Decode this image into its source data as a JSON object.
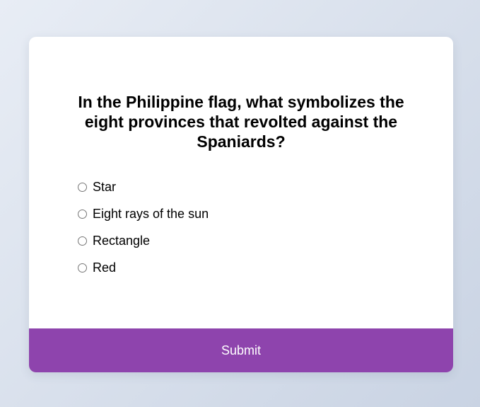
{
  "quiz": {
    "question": "In the Philippine flag, what symbolizes the eight provinces that revolted against the Spaniards?",
    "answers": [
      {
        "label": "Star",
        "selected": false
      },
      {
        "label": "Eight rays of the sun",
        "selected": false
      },
      {
        "label": "Rectangle",
        "selected": false
      },
      {
        "label": "Red",
        "selected": false
      }
    ],
    "submit_label": "Submit"
  },
  "colors": {
    "accent": "#8e44ad",
    "card_background": "#ffffff",
    "page_background": "#d8dfea"
  }
}
